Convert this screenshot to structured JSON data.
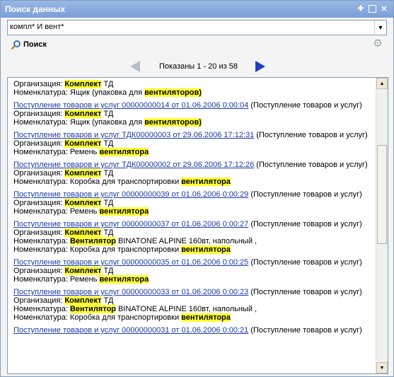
{
  "window": {
    "title": "Поиск данных"
  },
  "search": {
    "value": "компл* И вент*"
  },
  "toolbar": {
    "search_label": "Поиск"
  },
  "nav": {
    "status": "Показаны 1 - 20 из 58"
  },
  "results": [
    {
      "link": "",
      "suffix": "",
      "lines": [
        [
          {
            "t": "Организация: "
          },
          {
            "t": "Комплект",
            "hl": true
          },
          {
            "t": " ТД"
          }
        ],
        [
          {
            "t": "Номенклатура: Ящик (упаковка для "
          },
          {
            "t": "вентиляторов)",
            "hl": true
          }
        ]
      ]
    },
    {
      "link": "Поступление товаров и услуг 00000000014 от 01.06.2006 0:00:04",
      "suffix": " (Поступление товаров и услуг)",
      "lines": [
        [
          {
            "t": "Организация: "
          },
          {
            "t": "Комплект",
            "hl": true
          },
          {
            "t": " ТД"
          }
        ],
        [
          {
            "t": "Номенклатура: Ящик (упаковка для "
          },
          {
            "t": "вентиляторов)",
            "hl": true
          }
        ]
      ]
    },
    {
      "link": "Поступление товаров и услуг ТДК00000003 от 29.06.2006 17:12:31",
      "suffix": " (Поступление товаров и услуг)",
      "lines": [
        [
          {
            "t": "Организация: "
          },
          {
            "t": "Комплект",
            "hl": true
          },
          {
            "t": " ТД"
          }
        ],
        [
          {
            "t": "Номенклатура: Ремень "
          },
          {
            "t": "вентилятора",
            "hl": true
          }
        ]
      ]
    },
    {
      "link": "Поступление товаров и услуг ТДК00000002 от 29.06.2006 17:12:26",
      "suffix": " (Поступление товаров и услуг)",
      "lines": [
        [
          {
            "t": "Организация: "
          },
          {
            "t": "Комплект",
            "hl": true
          },
          {
            "t": " ТД"
          }
        ],
        [
          {
            "t": "Номенклатура: Коробка для транспортировки "
          },
          {
            "t": "вентилятора",
            "hl": true
          }
        ]
      ]
    },
    {
      "link": "Поступление товаров и услуг 00000000039 от 01.06.2006 0:00:29",
      "suffix": " (Поступление товаров и услуг)",
      "lines": [
        [
          {
            "t": "Организация: "
          },
          {
            "t": "Комплект",
            "hl": true
          },
          {
            "t": " ТД"
          }
        ],
        [
          {
            "t": "Номенклатура: Ремень "
          },
          {
            "t": "вентилятора",
            "hl": true
          }
        ]
      ]
    },
    {
      "link": "Поступление товаров и услуг 00000000037 от 01.06.2006 0:00:27",
      "suffix": " (Поступление товаров и услуг)",
      "lines": [
        [
          {
            "t": "Организация: "
          },
          {
            "t": "Комплект",
            "hl": true
          },
          {
            "t": " ТД"
          }
        ],
        [
          {
            "t": "Номенклатура: "
          },
          {
            "t": "Вентилятор",
            "hl": true
          },
          {
            "t": " BINATONE ALPINE 160вт, напольный ,"
          }
        ],
        [
          {
            "t": "Номенклатура: Коробка для транспортировки "
          },
          {
            "t": "вентилятора",
            "hl": true
          }
        ]
      ]
    },
    {
      "link": "Поступление товаров и услуг 00000000035 от 01.06.2006 0:00:25",
      "suffix": " (Поступление товаров и услуг)",
      "lines": [
        [
          {
            "t": "Организация: "
          },
          {
            "t": "Комплект",
            "hl": true
          },
          {
            "t": " ТД"
          }
        ],
        [
          {
            "t": "Номенклатура: Ремень "
          },
          {
            "t": "вентилятора",
            "hl": true
          }
        ]
      ]
    },
    {
      "link": "Поступление товаров и услуг 00000000033 от 01.06.2006 0:00:23",
      "suffix": " (Поступление товаров и услуг)",
      "lines": [
        [
          {
            "t": "Организация: "
          },
          {
            "t": "Комплект",
            "hl": true
          },
          {
            "t": " ТД"
          }
        ],
        [
          {
            "t": "Номенклатура: "
          },
          {
            "t": "Вентилятор",
            "hl": true
          },
          {
            "t": " BINATONE ALPINE 160вт, напольный ,"
          }
        ],
        [
          {
            "t": "Номенклатура: Коробка для транспортировки "
          },
          {
            "t": "вентилятора",
            "hl": true
          }
        ]
      ]
    },
    {
      "link": "Поступление товаров и услуг 00000000031 от 01.06.2006 0:00:21",
      "suffix": " (Поступление товаров и услуг)",
      "lines": []
    }
  ],
  "scrollbar": {
    "position": 0.32
  },
  "icons": {
    "search": "magnifier-icon",
    "settings": "gear-icon",
    "prev": "arrow-left-icon",
    "next": "arrow-right-icon"
  }
}
